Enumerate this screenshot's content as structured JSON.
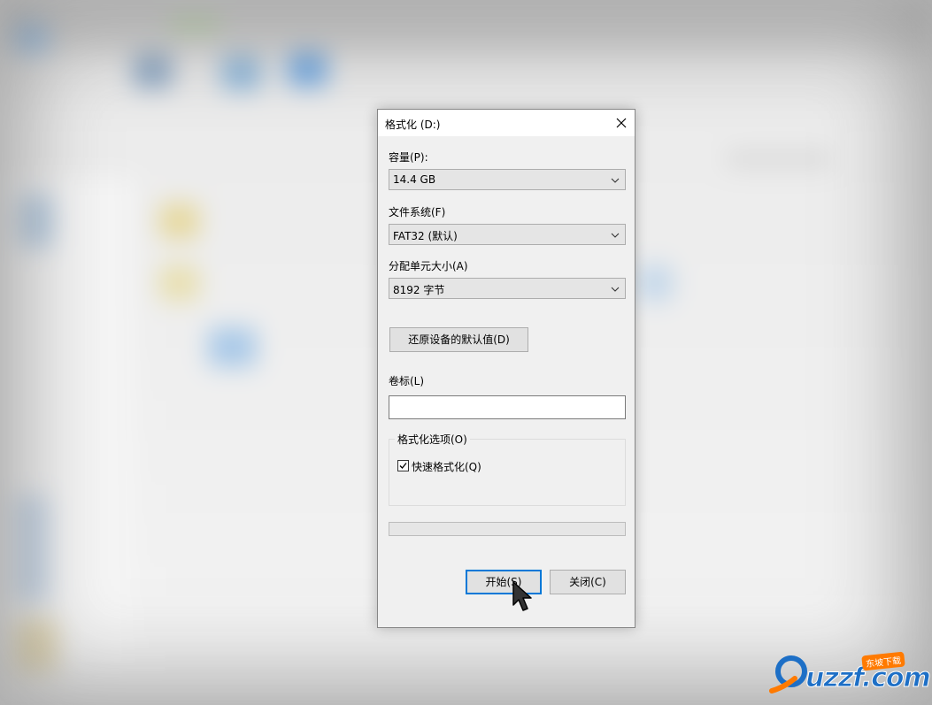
{
  "dialog": {
    "title": "格式化  (D:)",
    "capacity_label": "容量(P):",
    "capacity_value": "14.4 GB",
    "filesystem_label": "文件系统(F)",
    "filesystem_value": "FAT32 (默认)",
    "allocation_label": "分配单元大小(A)",
    "allocation_value": "8192 字节",
    "restore_defaults_label": "还原设备的默认值(D)",
    "volume_label_label": "卷标(L)",
    "volume_label_value": "",
    "format_options_label": "格式化选项(O)",
    "quick_format_label": "快速格式化(Q)",
    "quick_format_checked": true,
    "progress": 0,
    "start_label": "开始(S)",
    "close_label": "关闭(C)"
  },
  "watermark": {
    "logo_text": "uzzf.com",
    "badge_text": "东坡下载"
  },
  "colors": {
    "accent": "#0078d7",
    "dialog_bg": "#f0f0f0",
    "watermark_blue": "#1d6fc6",
    "watermark_orange": "#ff7a00"
  },
  "icons": [
    "close-icon",
    "chevron-down-icon",
    "check-icon",
    "mouse-cursor-icon"
  ]
}
